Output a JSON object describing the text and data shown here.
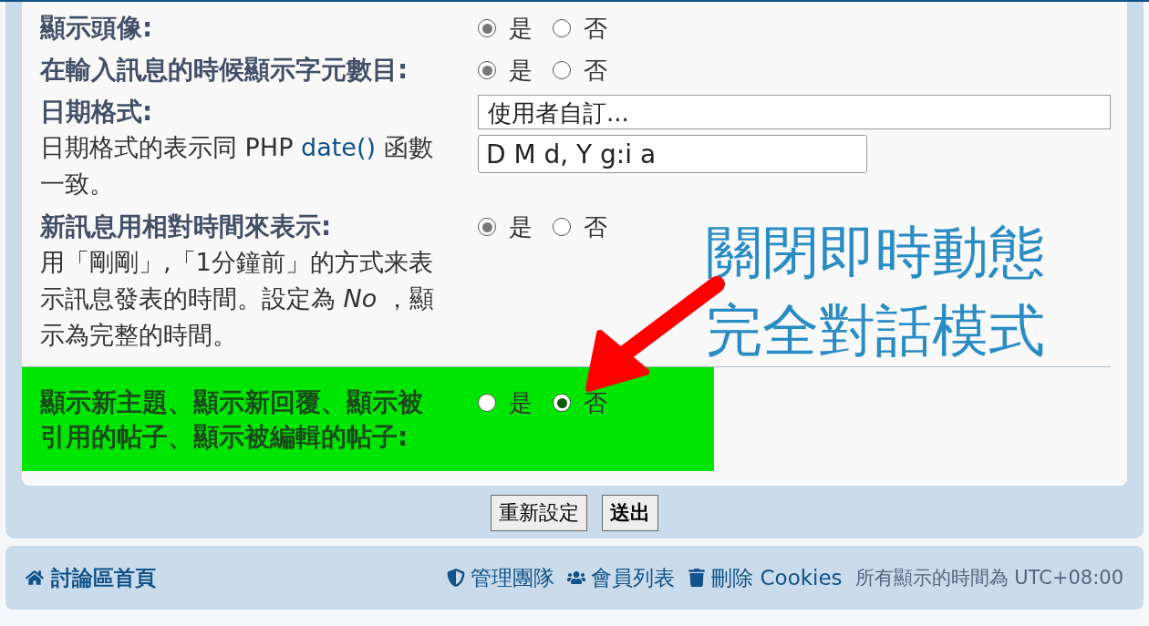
{
  "settings": [
    {
      "kind": "radio",
      "label": "顯示頭像:",
      "highlighted": false,
      "options": [
        {
          "label": "是",
          "selected": true
        },
        {
          "label": "否",
          "selected": false
        }
      ]
    },
    {
      "kind": "radio",
      "label": "在輸入訊息的時候顯示字元數目:",
      "highlighted": false,
      "options": [
        {
          "label": "是",
          "selected": true
        },
        {
          "label": "否",
          "selected": false
        }
      ]
    },
    {
      "kind": "date",
      "label": "日期格式:",
      "description": {
        "before": "日期格式的表示同 PHP ",
        "link": "date()",
        "after": " 函數一致。"
      },
      "select": "使用者自訂...",
      "value": "D M d, Y g:i a"
    },
    {
      "kind": "radio",
      "label": "新訊息用相對時間來表示:",
      "highlighted": false,
      "description": "用「剛剛」,「1分鐘前」的方式来表示訊息發表的時間。設定為 *No* ，顯示為完整的時間。",
      "options": [
        {
          "label": "是",
          "selected": true
        },
        {
          "label": "否",
          "selected": false
        }
      ]
    },
    {
      "kind": "radio",
      "label": "顯示新主題、顯示新回覆、顯示被引用的帖子、顯示被編輯的帖子:",
      "highlighted": true,
      "options": [
        {
          "label": "是",
          "selected": false
        },
        {
          "label": "否",
          "selected": true
        }
      ]
    }
  ],
  "annotation": {
    "lines": [
      "關閉即時動態",
      "完全對話模式"
    ]
  },
  "buttons": [
    {
      "label": "重新設定",
      "primary": false
    },
    {
      "label": "送出",
      "primary": true
    }
  ],
  "footer": {
    "home": "討論區首頁",
    "links": [
      {
        "label": "管理團隊"
      },
      {
        "label": "會員列表"
      },
      {
        "label": "刪除 Cookies"
      }
    ],
    "timezone": "所有顯示的時間為 UTC+08:00"
  }
}
